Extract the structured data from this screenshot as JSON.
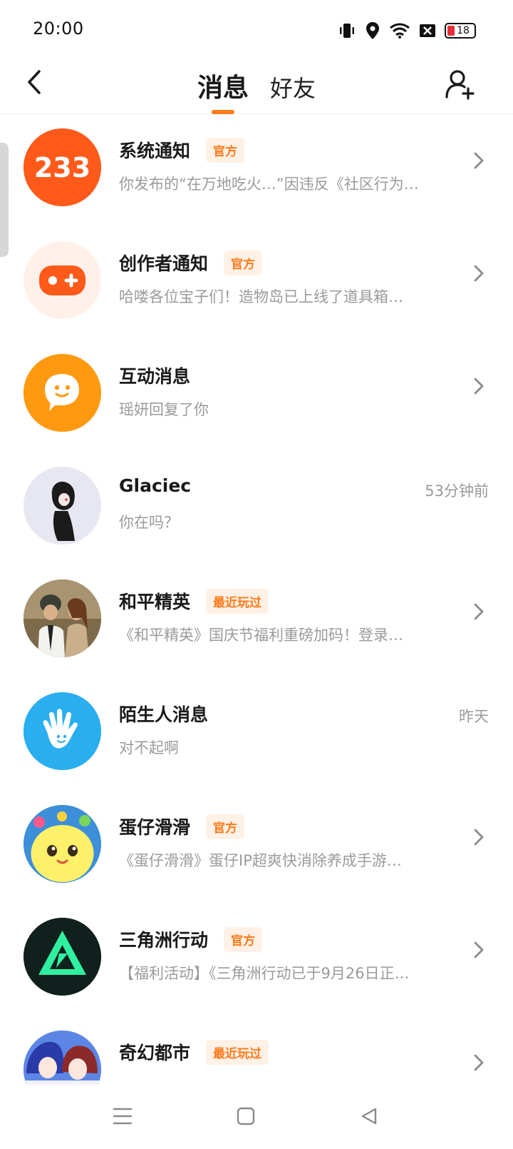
{
  "status_bar": {
    "time": "20:00",
    "battery": "18",
    "icons": [
      "vibrate-icon",
      "location-icon",
      "wifi-icon",
      "no-sim-icon",
      "battery-icon"
    ]
  },
  "header": {
    "back_icon": "back-arrow-icon",
    "tabs": [
      {
        "label": "消息",
        "active": true
      },
      {
        "label": "好友",
        "active": false
      }
    ],
    "add_friend_icon": "add-friend-icon"
  },
  "colors": {
    "accent": "#ff7a1a",
    "tag_bg": "#fff1e6",
    "secondary_text": "#9a9a9a"
  },
  "messages": [
    {
      "name": "系统通知",
      "tag": "官方",
      "preview": "你发布的“在万地吃火…”因违反《社区行为…",
      "time": "",
      "avatar": "233-logo",
      "avatar_text": "233",
      "chevron": true
    },
    {
      "name": "创作者通知",
      "tag": "官方",
      "preview": "哈喽各位宝子们！造物岛已上线了道具箱…",
      "time": "",
      "avatar": "gamepad-icon",
      "chevron": true
    },
    {
      "name": "互动消息",
      "tag": "",
      "preview": "瑶妍回复了你",
      "time": "",
      "avatar": "chat-bubble-icon",
      "chevron": true
    },
    {
      "name": "Glaciec",
      "tag": "",
      "preview": "你在吗？",
      "time": "53分钟前",
      "avatar": "user-avatar",
      "chevron": false
    },
    {
      "name": "和平精英",
      "tag": "最近玩过",
      "preview": "《和平精英》国庆节福利重磅加码！登录…",
      "time": "",
      "avatar": "game-avatar",
      "chevron": true
    },
    {
      "name": "陌生人消息",
      "tag": "",
      "preview": "对不起啊",
      "time": "昨天",
      "avatar": "hand-wave-icon",
      "chevron": false
    },
    {
      "name": "蛋仔滑滑",
      "tag": "官方",
      "preview": "《蛋仔滑滑》蛋仔IP超爽快消除养成手游…",
      "time": "",
      "avatar": "game-avatar",
      "chevron": true
    },
    {
      "name": "三角洲行动",
      "tag": "官方",
      "preview": "【福利活动】《三角洲行动已于9月26日正…",
      "time": "",
      "avatar": "game-avatar",
      "chevron": true
    },
    {
      "name": "奇幻都市",
      "tag": "最近玩过",
      "preview": "",
      "time": "",
      "avatar": "game-avatar",
      "chevron": true
    }
  ],
  "bottom_nav": {
    "icons": [
      "menu-icon",
      "home-square-icon",
      "back-triangle-icon"
    ]
  }
}
